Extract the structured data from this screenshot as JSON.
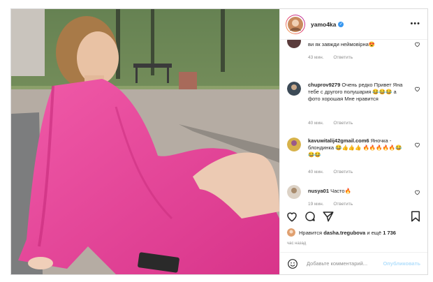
{
  "post": {
    "username": "yamo4ka",
    "verified": true
  },
  "comments": [
    {
      "user": "",
      "text": "ви як завжди неймовірна😍",
      "time": "43 мин.",
      "reply": "Ответить"
    },
    {
      "user": "chuprov9279",
      "text": "Очень редко Привет Яна тебе с другого полушария 😂😂😂 а фото хорошая Мне нравится",
      "time": "40 мин.",
      "reply": "Ответить"
    },
    {
      "user": "kavuwitalij42gmail.com6",
      "text": "Яночка - блондинка 😂👍👍👍 🔥🔥🔥🔥🔥😂😂😂",
      "time": "40 мин.",
      "reply": "Ответить"
    },
    {
      "user": "nusya01",
      "text": "Часто🔥",
      "time": "19 мин.",
      "reply": "Ответить"
    }
  ],
  "likes": {
    "prefix": "Нравится",
    "user": "dasha.tregubova",
    "and_more": "и ещё",
    "count": "1 736"
  },
  "timestamp": "час назад",
  "comment_input": {
    "placeholder": "Добавьте комментарий...",
    "publish_label": "Опубликовать"
  },
  "colors": {
    "robe": "#e8439a",
    "verified": "#3897f0",
    "publish_disabled": "#b2dffc"
  },
  "icons": [
    "heart-icon",
    "comment-icon",
    "share-icon",
    "bookmark-icon",
    "smiley-icon",
    "more-icon",
    "verified-icon"
  ]
}
